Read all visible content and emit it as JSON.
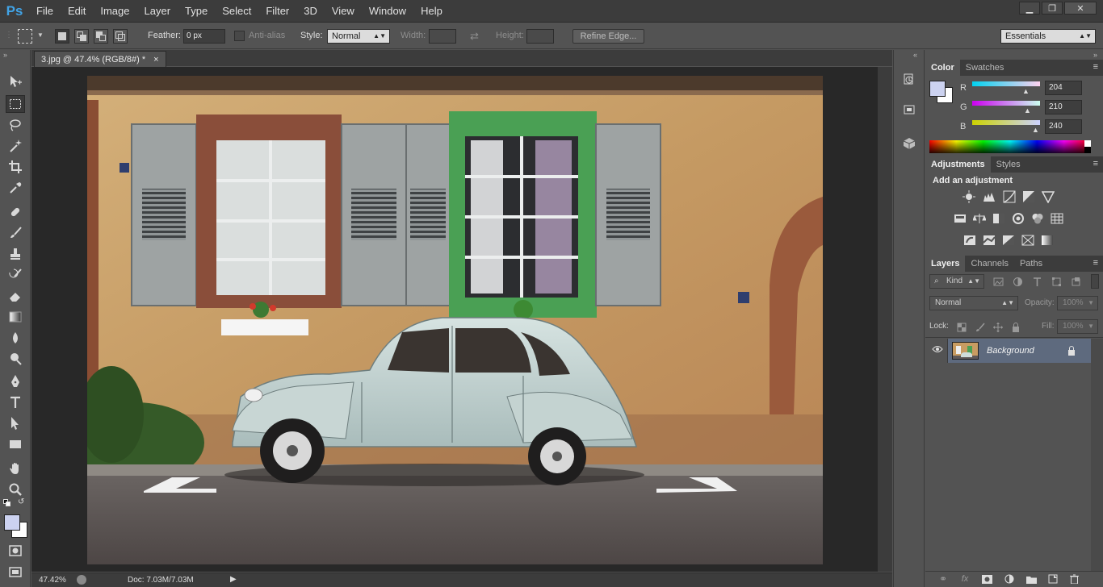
{
  "app": {
    "logo_text": "Ps"
  },
  "menu": [
    "File",
    "Edit",
    "Image",
    "Layer",
    "Type",
    "Select",
    "Filter",
    "3D",
    "View",
    "Window",
    "Help"
  ],
  "window_controls": {
    "minimize": "▁",
    "restore": "❐",
    "close": "✕"
  },
  "options_bar": {
    "feather_label": "Feather:",
    "feather_value": "0 px",
    "antialias_label": "Anti-alias",
    "style_label": "Style:",
    "style_value": "Normal",
    "width_label": "Width:",
    "height_label": "Height:",
    "refine_edge_label": "Refine Edge...",
    "workspace_value": "Essentials"
  },
  "document": {
    "tab_title": "3.jpg @ 47.4% (RGB/8#) *",
    "tab_close": "×",
    "zoom": "47.42%",
    "doc_info": "Doc: 7.03M/7.03M",
    "status_arrow": "▶"
  },
  "color_panel": {
    "tabs": [
      "Color",
      "Swatches"
    ],
    "r_label": "R",
    "g_label": "G",
    "b_label": "B",
    "r": "204",
    "g": "210",
    "b": "240",
    "fill_fraction": {
      "r": 0.8,
      "g": 0.82,
      "b": 0.94
    },
    "fg_color": "#ccd2f0",
    "bg_color": "#ffffff"
  },
  "adjustments_panel": {
    "tabs": [
      "Adjustments",
      "Styles"
    ],
    "heading": "Add an adjustment",
    "row1": [
      "brightness-contrast-icon",
      "levels-icon",
      "curves-icon",
      "exposure-icon",
      "vibrance-icon"
    ],
    "row2": [
      "hue-saturation-icon",
      "color-balance-icon",
      "black-white-icon",
      "photo-filter-icon",
      "channel-mixer-icon",
      "color-lookup-icon"
    ],
    "row3": [
      "invert-icon",
      "posterize-icon",
      "threshold-icon",
      "selective-color-icon",
      "gradient-map-icon"
    ]
  },
  "layers_panel": {
    "tabs": [
      "Layers",
      "Channels",
      "Paths"
    ],
    "kind_label": "Kind",
    "blend_mode": "Normal",
    "opacity_label": "Opacity:",
    "opacity_value": "100%",
    "lock_label": "Lock:",
    "fill_label": "Fill:",
    "fill_value": "100%",
    "layers": [
      {
        "name": "Background",
        "visible": true,
        "locked": true
      }
    ]
  }
}
